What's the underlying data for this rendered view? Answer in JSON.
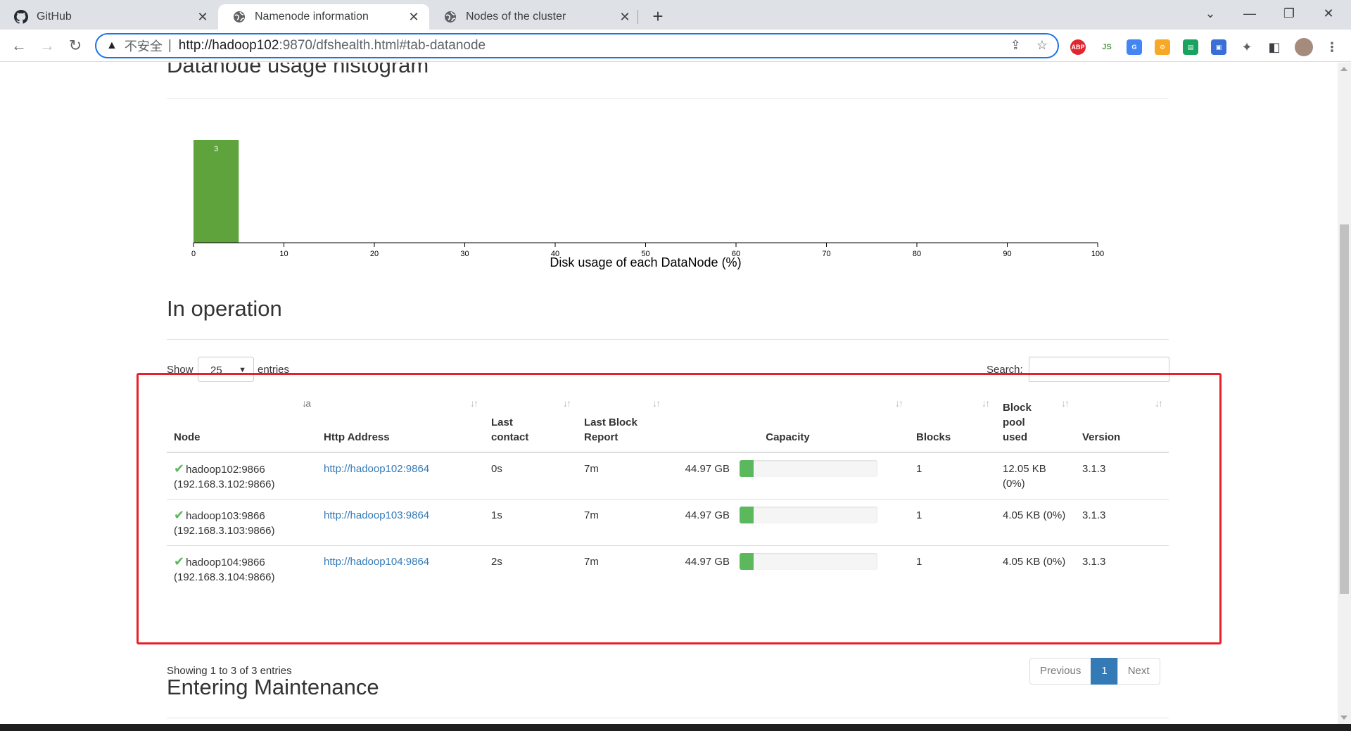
{
  "browser": {
    "tabs": [
      {
        "title": "GitHub",
        "icon": "github-icon"
      },
      {
        "title": "Namenode information",
        "icon": "globe-icon"
      },
      {
        "title": "Nodes of the cluster",
        "icon": "globe-icon"
      }
    ],
    "active_tab": 1,
    "omnibox": {
      "warning": "不安全",
      "url_host": "http://hadoop102",
      "url_path": ":9870/dfshealth.html#tab-datanode"
    }
  },
  "page": {
    "histogram_title": "Datanode usage histogram",
    "in_operation_title": "In operation",
    "entering_maintenance_title": "Entering Maintenance",
    "show_label": "Show",
    "entries_label": "entries",
    "page_length": "25",
    "search_label": "Search:",
    "table": {
      "columns": [
        "Node",
        "Http Address",
        "Last contact",
        "Last Block Report",
        "Capacity",
        "Blocks",
        "Block pool used",
        "Version"
      ],
      "rows": [
        {
          "node": "hadoop102:9866",
          "node_ip": "(192.168.3.102:9866)",
          "http": "http://hadoop102:9864",
          "last_contact": "0s",
          "last_block_report": "7m",
          "capacity": "44.97 GB",
          "capacity_used_fraction": 0.1,
          "blocks": "1",
          "block_pool_used": "12.05 KB (0%)",
          "version": "3.1.3"
        },
        {
          "node": "hadoop103:9866",
          "node_ip": "(192.168.3.103:9866)",
          "http": "http://hadoop103:9864",
          "last_contact": "1s",
          "last_block_report": "7m",
          "capacity": "44.97 GB",
          "capacity_used_fraction": 0.1,
          "blocks": "1",
          "block_pool_used": "4.05 KB (0%)",
          "version": "3.1.3"
        },
        {
          "node": "hadoop104:9866",
          "node_ip": "(192.168.3.104:9866)",
          "http": "http://hadoop104:9864",
          "last_contact": "2s",
          "last_block_report": "7m",
          "capacity": "44.97 GB",
          "capacity_used_fraction": 0.1,
          "blocks": "1",
          "block_pool_used": "4.05 KB (0%)",
          "version": "3.1.3"
        }
      ]
    },
    "info_text": "Showing 1 to 3 of 3 entries",
    "pager": {
      "previous": "Previous",
      "current": "1",
      "next": "Next"
    }
  },
  "chart_data": {
    "type": "bar",
    "title": "",
    "xlabel": "Disk usage of each DataNode (%)",
    "ylabel": "",
    "x_ticks": [
      0,
      10,
      20,
      30,
      40,
      50,
      60,
      70,
      80,
      90,
      100
    ],
    "xlim": [
      0,
      100
    ],
    "bins": [
      {
        "x0": 0,
        "x1": 5,
        "count": 3
      }
    ],
    "bar_color": "#5ea33c",
    "grid": false
  },
  "colors": {
    "accent": "#337ab7",
    "success": "#5cb85c",
    "highlight": "#e8202a"
  }
}
